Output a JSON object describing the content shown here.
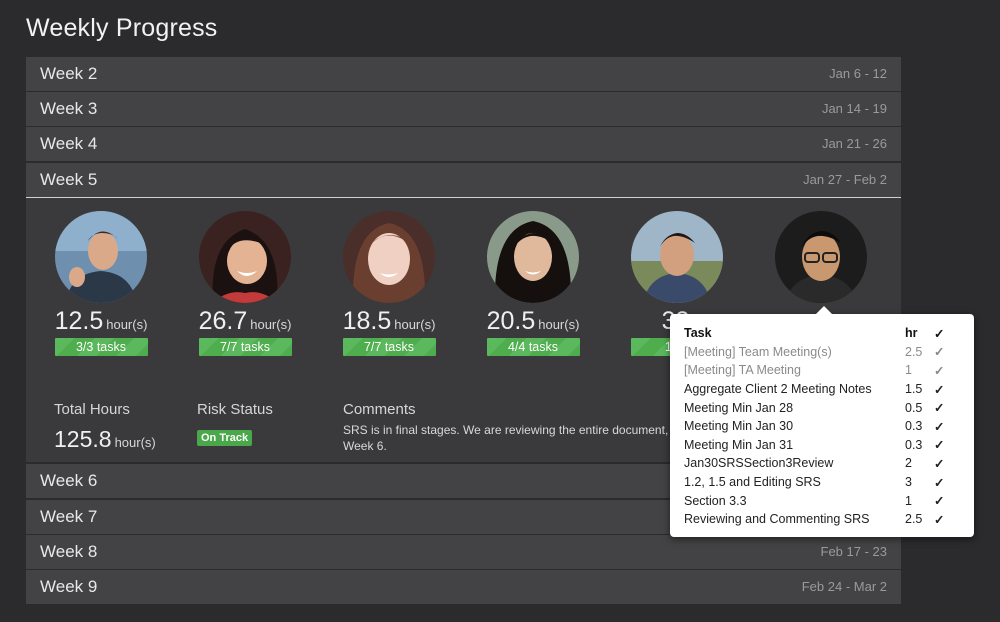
{
  "page": {
    "title": "Weekly Progress"
  },
  "weeks_top": [
    {
      "label": "Week 2",
      "dates": "Jan 6 - 12"
    },
    {
      "label": "Week 3",
      "dates": "Jan 14 - 19"
    },
    {
      "label": "Week 4",
      "dates": "Jan 21 - 26"
    },
    {
      "label": "Week 5",
      "dates": "Jan 27 - Feb 2"
    }
  ],
  "weeks_bottom": [
    {
      "label": "Week 6",
      "dates": ""
    },
    {
      "label": "Week 7",
      "dates": ""
    },
    {
      "label": "Week 8",
      "dates": "Feb 17 - 23"
    },
    {
      "label": "Week 9",
      "dates": "Feb 24 - Mar 2"
    }
  ],
  "members": [
    {
      "hours": "12.5",
      "unit": "hour(s)",
      "tasks": "3/3 tasks"
    },
    {
      "hours": "26.7",
      "unit": "hour(s)",
      "tasks": "7/7 tasks"
    },
    {
      "hours": "18.5",
      "unit": "hour(s)",
      "tasks": "7/7 tasks"
    },
    {
      "hours": "20.5",
      "unit": "hour(s)",
      "tasks": "4/4 tasks"
    },
    {
      "hours": "33",
      "unit": "",
      "tasks": "12/1"
    }
  ],
  "summary": {
    "total_label": "Total Hours",
    "total_value": "125.8",
    "total_unit": "hour(s)",
    "risk_label": "Risk Status",
    "risk_value": "On Track",
    "comments_label": "Comments",
    "comments_text": "SRS is in final stages. We are reviewing the entire document, a Week 6."
  },
  "popover": {
    "headers": {
      "task": "Task",
      "hr": "hr",
      "check": "✓"
    },
    "rows": [
      {
        "task": "[Meeting] Team Meeting(s)",
        "hr": "2.5",
        "check": "✓",
        "dim": true
      },
      {
        "task": "[Meeting] TA Meeting",
        "hr": "1",
        "check": "✓",
        "dim": true
      },
      {
        "task": "Aggregate Client 2 Meeting Notes",
        "hr": "1.5",
        "check": "✓",
        "dim": false
      },
      {
        "task": "Meeting Min Jan 28",
        "hr": "0.5",
        "check": "✓",
        "dim": false
      },
      {
        "task": "Meeting Min Jan 30",
        "hr": "0.3",
        "check": "✓",
        "dim": false
      },
      {
        "task": "Meeting Min Jan 31",
        "hr": "0.3",
        "check": "✓",
        "dim": false
      },
      {
        "task": "Jan30SRSSection3Review",
        "hr": "2",
        "check": "✓",
        "dim": false
      },
      {
        "task": "1.2, 1.5 and Editing SRS",
        "hr": "3",
        "check": "✓",
        "dim": false
      },
      {
        "task": "Section 3.3",
        "hr": "1",
        "check": "✓",
        "dim": false
      },
      {
        "task": "Reviewing and Commenting SRS",
        "hr": "2.5",
        "check": "✓",
        "dim": false
      }
    ]
  },
  "colors": {
    "background": "#2b2b2d",
    "row": "#434345",
    "panel": "#3a3a3c",
    "badge_green": "#5cb85c"
  },
  "icons": {
    "avatar": "user-photo"
  }
}
